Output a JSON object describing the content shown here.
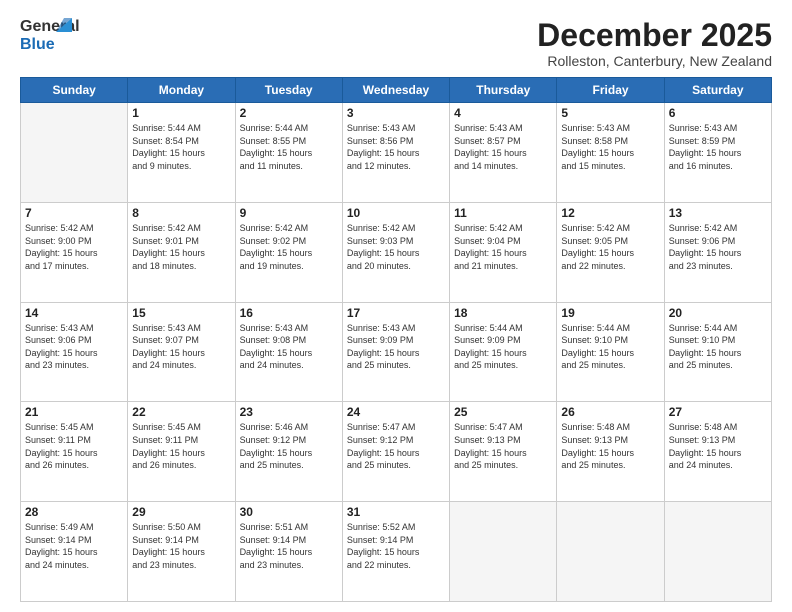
{
  "header": {
    "logo_general": "General",
    "logo_blue": "Blue",
    "month_title": "December 2025",
    "location": "Rolleston, Canterbury, New Zealand"
  },
  "days_of_week": [
    "Sunday",
    "Monday",
    "Tuesday",
    "Wednesday",
    "Thursday",
    "Friday",
    "Saturday"
  ],
  "weeks": [
    [
      {
        "day": "",
        "info": ""
      },
      {
        "day": "1",
        "info": "Sunrise: 5:44 AM\nSunset: 8:54 PM\nDaylight: 15 hours\nand 9 minutes."
      },
      {
        "day": "2",
        "info": "Sunrise: 5:44 AM\nSunset: 8:55 PM\nDaylight: 15 hours\nand 11 minutes."
      },
      {
        "day": "3",
        "info": "Sunrise: 5:43 AM\nSunset: 8:56 PM\nDaylight: 15 hours\nand 12 minutes."
      },
      {
        "day": "4",
        "info": "Sunrise: 5:43 AM\nSunset: 8:57 PM\nDaylight: 15 hours\nand 14 minutes."
      },
      {
        "day": "5",
        "info": "Sunrise: 5:43 AM\nSunset: 8:58 PM\nDaylight: 15 hours\nand 15 minutes."
      },
      {
        "day": "6",
        "info": "Sunrise: 5:43 AM\nSunset: 8:59 PM\nDaylight: 15 hours\nand 16 minutes."
      }
    ],
    [
      {
        "day": "7",
        "info": "Sunrise: 5:42 AM\nSunset: 9:00 PM\nDaylight: 15 hours\nand 17 minutes."
      },
      {
        "day": "8",
        "info": "Sunrise: 5:42 AM\nSunset: 9:01 PM\nDaylight: 15 hours\nand 18 minutes."
      },
      {
        "day": "9",
        "info": "Sunrise: 5:42 AM\nSunset: 9:02 PM\nDaylight: 15 hours\nand 19 minutes."
      },
      {
        "day": "10",
        "info": "Sunrise: 5:42 AM\nSunset: 9:03 PM\nDaylight: 15 hours\nand 20 minutes."
      },
      {
        "day": "11",
        "info": "Sunrise: 5:42 AM\nSunset: 9:04 PM\nDaylight: 15 hours\nand 21 minutes."
      },
      {
        "day": "12",
        "info": "Sunrise: 5:42 AM\nSunset: 9:05 PM\nDaylight: 15 hours\nand 22 minutes."
      },
      {
        "day": "13",
        "info": "Sunrise: 5:42 AM\nSunset: 9:06 PM\nDaylight: 15 hours\nand 23 minutes."
      }
    ],
    [
      {
        "day": "14",
        "info": "Sunrise: 5:43 AM\nSunset: 9:06 PM\nDaylight: 15 hours\nand 23 minutes."
      },
      {
        "day": "15",
        "info": "Sunrise: 5:43 AM\nSunset: 9:07 PM\nDaylight: 15 hours\nand 24 minutes."
      },
      {
        "day": "16",
        "info": "Sunrise: 5:43 AM\nSunset: 9:08 PM\nDaylight: 15 hours\nand 24 minutes."
      },
      {
        "day": "17",
        "info": "Sunrise: 5:43 AM\nSunset: 9:09 PM\nDaylight: 15 hours\nand 25 minutes."
      },
      {
        "day": "18",
        "info": "Sunrise: 5:44 AM\nSunset: 9:09 PM\nDaylight: 15 hours\nand 25 minutes."
      },
      {
        "day": "19",
        "info": "Sunrise: 5:44 AM\nSunset: 9:10 PM\nDaylight: 15 hours\nand 25 minutes."
      },
      {
        "day": "20",
        "info": "Sunrise: 5:44 AM\nSunset: 9:10 PM\nDaylight: 15 hours\nand 25 minutes."
      }
    ],
    [
      {
        "day": "21",
        "info": "Sunrise: 5:45 AM\nSunset: 9:11 PM\nDaylight: 15 hours\nand 26 minutes."
      },
      {
        "day": "22",
        "info": "Sunrise: 5:45 AM\nSunset: 9:11 PM\nDaylight: 15 hours\nand 26 minutes."
      },
      {
        "day": "23",
        "info": "Sunrise: 5:46 AM\nSunset: 9:12 PM\nDaylight: 15 hours\nand 25 minutes."
      },
      {
        "day": "24",
        "info": "Sunrise: 5:47 AM\nSunset: 9:12 PM\nDaylight: 15 hours\nand 25 minutes."
      },
      {
        "day": "25",
        "info": "Sunrise: 5:47 AM\nSunset: 9:13 PM\nDaylight: 15 hours\nand 25 minutes."
      },
      {
        "day": "26",
        "info": "Sunrise: 5:48 AM\nSunset: 9:13 PM\nDaylight: 15 hours\nand 25 minutes."
      },
      {
        "day": "27",
        "info": "Sunrise: 5:48 AM\nSunset: 9:13 PM\nDaylight: 15 hours\nand 24 minutes."
      }
    ],
    [
      {
        "day": "28",
        "info": "Sunrise: 5:49 AM\nSunset: 9:14 PM\nDaylight: 15 hours\nand 24 minutes."
      },
      {
        "day": "29",
        "info": "Sunrise: 5:50 AM\nSunset: 9:14 PM\nDaylight: 15 hours\nand 23 minutes."
      },
      {
        "day": "30",
        "info": "Sunrise: 5:51 AM\nSunset: 9:14 PM\nDaylight: 15 hours\nand 23 minutes."
      },
      {
        "day": "31",
        "info": "Sunrise: 5:52 AM\nSunset: 9:14 PM\nDaylight: 15 hours\nand 22 minutes."
      },
      {
        "day": "",
        "info": ""
      },
      {
        "day": "",
        "info": ""
      },
      {
        "day": "",
        "info": ""
      }
    ]
  ]
}
